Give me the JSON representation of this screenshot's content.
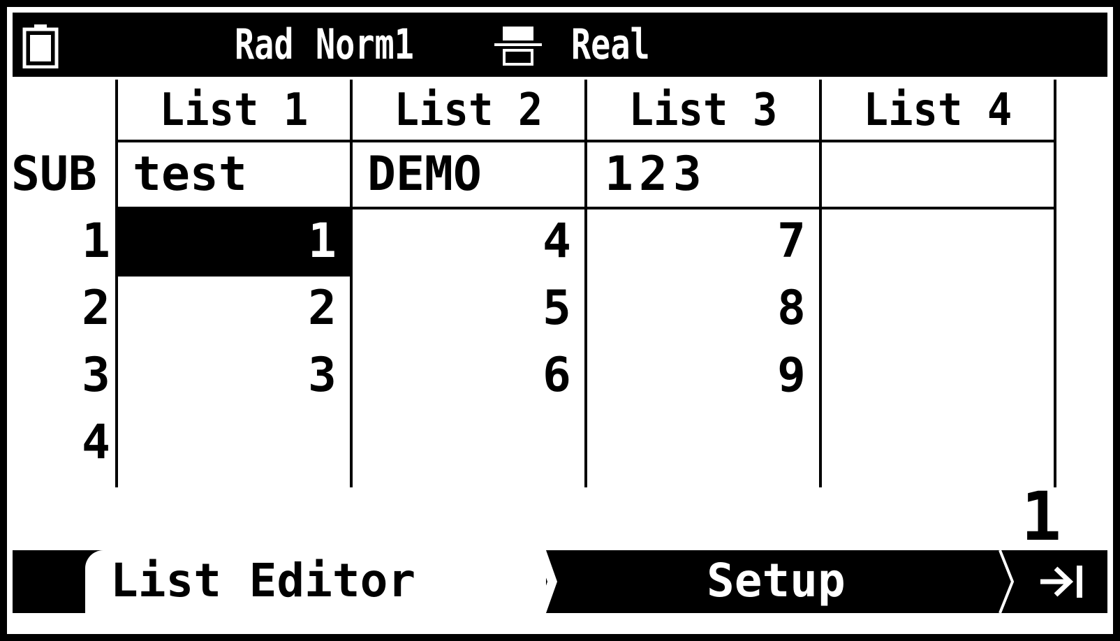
{
  "status": {
    "angle_mode": "Rad",
    "display_mode": "Norm1",
    "complex_mode": "Real",
    "icons": [
      "battery-icon",
      "fraction-format-icon"
    ]
  },
  "table": {
    "row_label_sub": "SUB",
    "columns": [
      {
        "header": "List 1",
        "sub": "test",
        "values": [
          "1",
          "2",
          "3",
          ""
        ]
      },
      {
        "header": "List 2",
        "sub": "DEMO",
        "values": [
          "4",
          "5",
          "6",
          ""
        ]
      },
      {
        "header": "List 3",
        "sub": "123",
        "values": [
          "7",
          "8",
          "9",
          ""
        ]
      },
      {
        "header": "List 4",
        "sub": "",
        "values": [
          "",
          "",
          "",
          ""
        ]
      }
    ],
    "row_indices": [
      "1",
      "2",
      "3",
      "4"
    ],
    "selected": {
      "column": "List 1",
      "row": "1"
    }
  },
  "cursor_row": "1",
  "menu": {
    "tabs": [
      {
        "label": "List Editor",
        "active": true
      },
      {
        "label": "Setup",
        "active": false
      }
    ],
    "next_icon": "next-page-icon"
  },
  "colors": {
    "foreground": "#000000",
    "background": "#ffffff"
  }
}
